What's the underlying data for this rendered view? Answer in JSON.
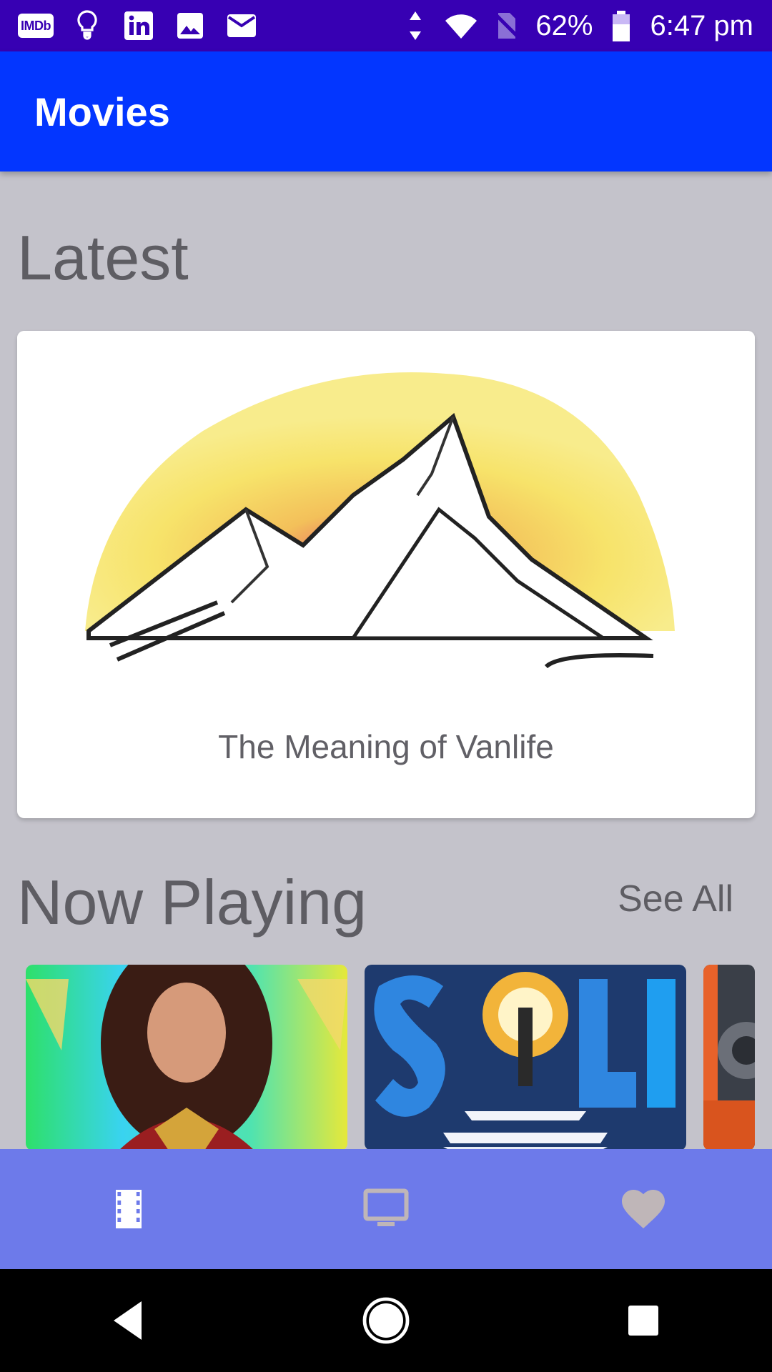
{
  "status_bar": {
    "battery": "62%",
    "time": "6:47 pm",
    "notification_icons": [
      "imdb-icon",
      "lightbulb-icon",
      "linkedin-icon",
      "image-icon",
      "mail-icon"
    ],
    "imdb_label": "IMDb",
    "system_icons": [
      "data-arrows-icon",
      "wifi-icon",
      "no-sim-icon",
      "battery-icon"
    ]
  },
  "app_bar": {
    "title": "Movies"
  },
  "latest": {
    "heading": "Latest",
    "card": {
      "title": "The Meaning of Vanlife"
    }
  },
  "now_playing": {
    "heading": "Now Playing",
    "see_all_label": "See All",
    "posters": [
      {
        "name": "poster-wonder-woman"
      },
      {
        "name": "poster-soul"
      },
      {
        "name": "poster-partial"
      }
    ]
  },
  "bottom_nav": {
    "items": [
      {
        "icon": "movie-icon",
        "selected": true
      },
      {
        "icon": "tv-icon",
        "selected": false
      },
      {
        "icon": "heart-icon",
        "selected": false
      }
    ]
  },
  "colors": {
    "status_bar": "#3700b3",
    "app_bar": "#0336ff",
    "background": "#c4c3cb",
    "bottom_nav": "#6d7aea",
    "nav_selected": "#ffffff",
    "nav_unselected": "#bfb6b8"
  }
}
